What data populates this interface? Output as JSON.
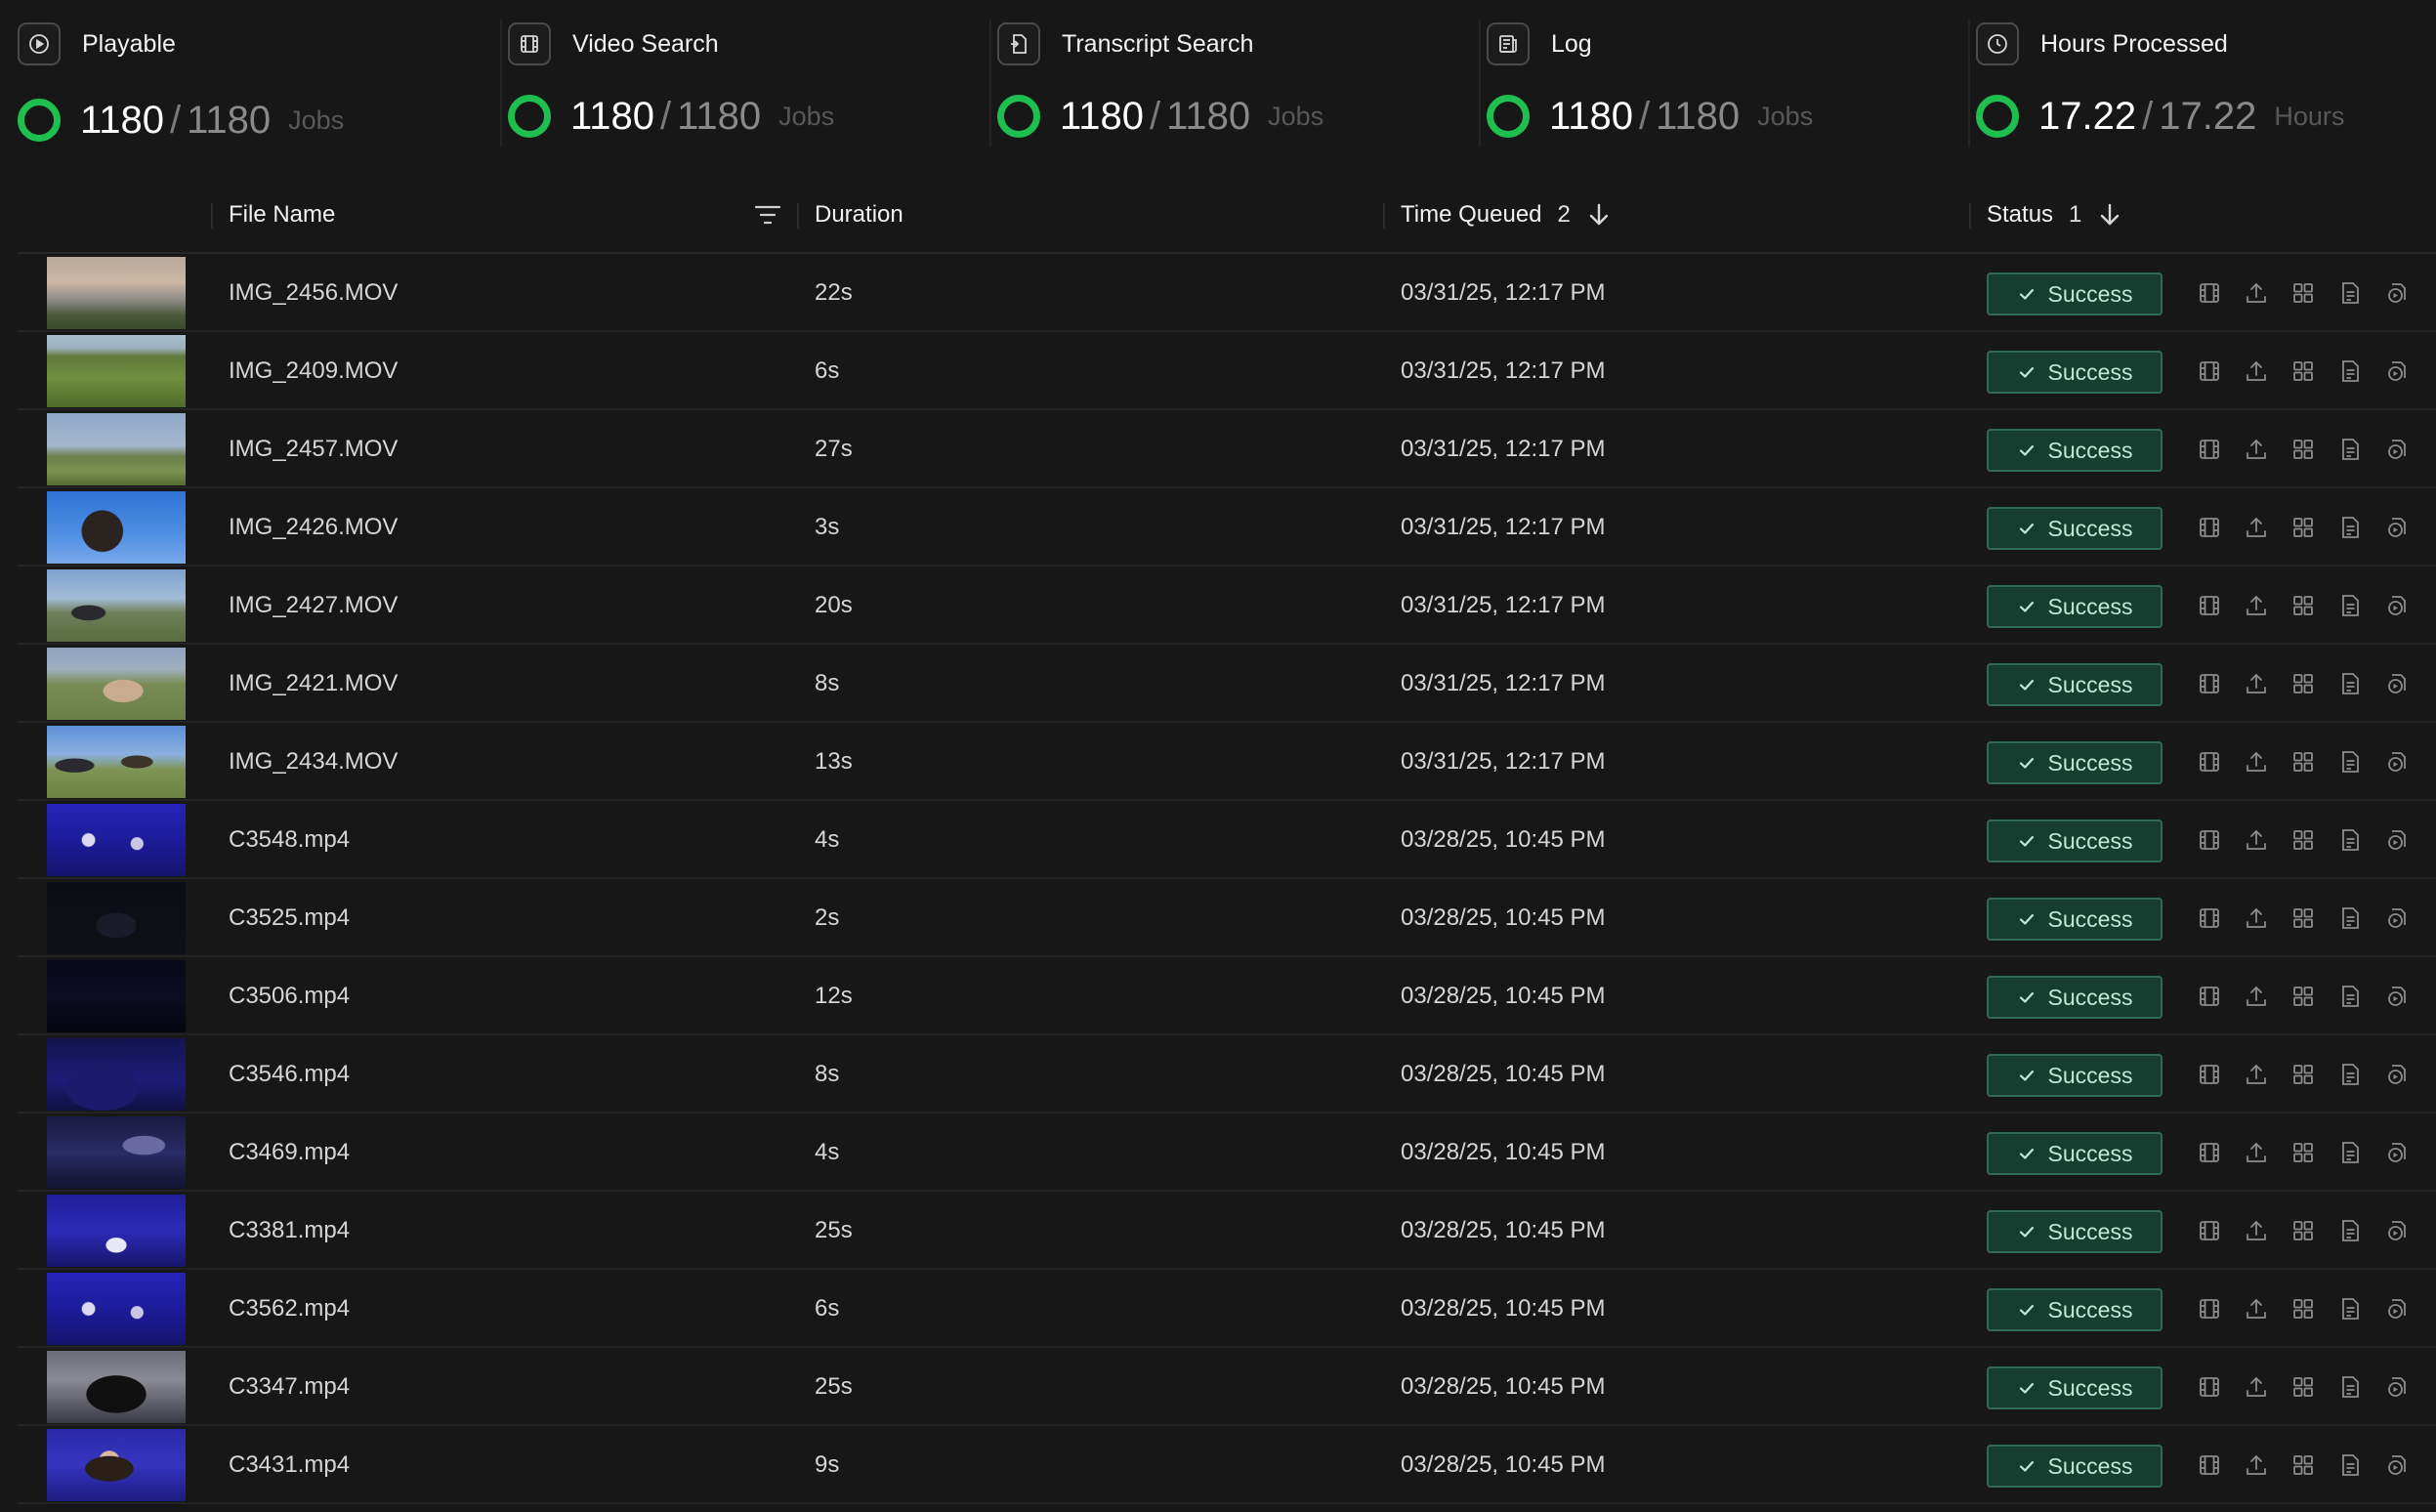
{
  "stats": [
    {
      "label": "Playable",
      "icon": "play-circle-icon",
      "done": "1180",
      "total": "1180",
      "unit": "Jobs"
    },
    {
      "label": "Video Search",
      "icon": "film-icon",
      "done": "1180",
      "total": "1180",
      "unit": "Jobs"
    },
    {
      "label": "Transcript Search",
      "icon": "transcript-icon",
      "done": "1180",
      "total": "1180",
      "unit": "Jobs"
    },
    {
      "label": "Log",
      "icon": "log-icon",
      "done": "1180",
      "total": "1180",
      "unit": "Jobs"
    },
    {
      "label": "Hours Processed",
      "icon": "clock-icon",
      "done": "17.22",
      "total": "17.22",
      "unit": "Hours"
    }
  ],
  "table": {
    "columns": {
      "file_name": "File Name",
      "duration": "Duration",
      "time_queued": "Time Queued",
      "time_queued_sort_order": "2",
      "status": "Status",
      "status_sort_order": "1"
    },
    "rows": [
      {
        "file": "IMG_2456.MOV",
        "duration": "22s",
        "queued": "03/31/25, 12:17 PM",
        "status": "Success",
        "thumb": "landscape-sunset"
      },
      {
        "file": "IMG_2409.MOV",
        "duration": "6s",
        "queued": "03/31/25, 12:17 PM",
        "status": "Success",
        "thumb": "green-hills"
      },
      {
        "file": "IMG_2457.MOV",
        "duration": "27s",
        "queued": "03/31/25, 12:17 PM",
        "status": "Success",
        "thumb": "field-fence"
      },
      {
        "file": "IMG_2426.MOV",
        "duration": "3s",
        "queued": "03/31/25, 12:17 PM",
        "status": "Success",
        "thumb": "portrait-sky"
      },
      {
        "file": "IMG_2427.MOV",
        "duration": "20s",
        "queued": "03/31/25, 12:17 PM",
        "status": "Success",
        "thumb": "person-hill"
      },
      {
        "file": "IMG_2421.MOV",
        "duration": "8s",
        "queued": "03/31/25, 12:17 PM",
        "status": "Success",
        "thumb": "cow-field"
      },
      {
        "file": "IMG_2434.MOV",
        "duration": "13s",
        "queued": "03/31/25, 12:17 PM",
        "status": "Success",
        "thumb": "two-people-field"
      },
      {
        "file": "C3548.mp4",
        "duration": "4s",
        "queued": "03/28/25, 10:45 PM",
        "status": "Success",
        "thumb": "blue-crowd"
      },
      {
        "file": "C3525.mp4",
        "duration": "2s",
        "queued": "03/28/25, 10:45 PM",
        "status": "Success",
        "thumb": "dark-stage"
      },
      {
        "file": "C3506.mp4",
        "duration": "12s",
        "queued": "03/28/25, 10:45 PM",
        "status": "Success",
        "thumb": "dark-blue"
      },
      {
        "file": "C3546.mp4",
        "duration": "8s",
        "queued": "03/28/25, 10:45 PM",
        "status": "Success",
        "thumb": "blue-audience"
      },
      {
        "file": "C3469.mp4",
        "duration": "4s",
        "queued": "03/28/25, 10:45 PM",
        "status": "Success",
        "thumb": "stage-lights"
      },
      {
        "file": "C3381.mp4",
        "duration": "25s",
        "queued": "03/28/25, 10:45 PM",
        "status": "Success",
        "thumb": "blue-hall"
      },
      {
        "file": "C3562.mp4",
        "duration": "6s",
        "queued": "03/28/25, 10:45 PM",
        "status": "Success",
        "thumb": "blue-crowd"
      },
      {
        "file": "C3347.mp4",
        "duration": "25s",
        "queued": "03/28/25, 10:45 PM",
        "status": "Success",
        "thumb": "group-dark"
      },
      {
        "file": "C3431.mp4",
        "duration": "9s",
        "queued": "03/28/25, 10:45 PM",
        "status": "Success",
        "thumb": "interview-blue"
      }
    ],
    "row_actions": [
      "film-icon",
      "upload-icon",
      "grid-icon",
      "document-icon",
      "transcript-icon"
    ]
  },
  "colors": {
    "background": "#171717",
    "ring_green": "#1fbf4f",
    "success_bg": "#163d2f",
    "success_border": "#2f6a52",
    "success_text": "#bfe8d4"
  }
}
